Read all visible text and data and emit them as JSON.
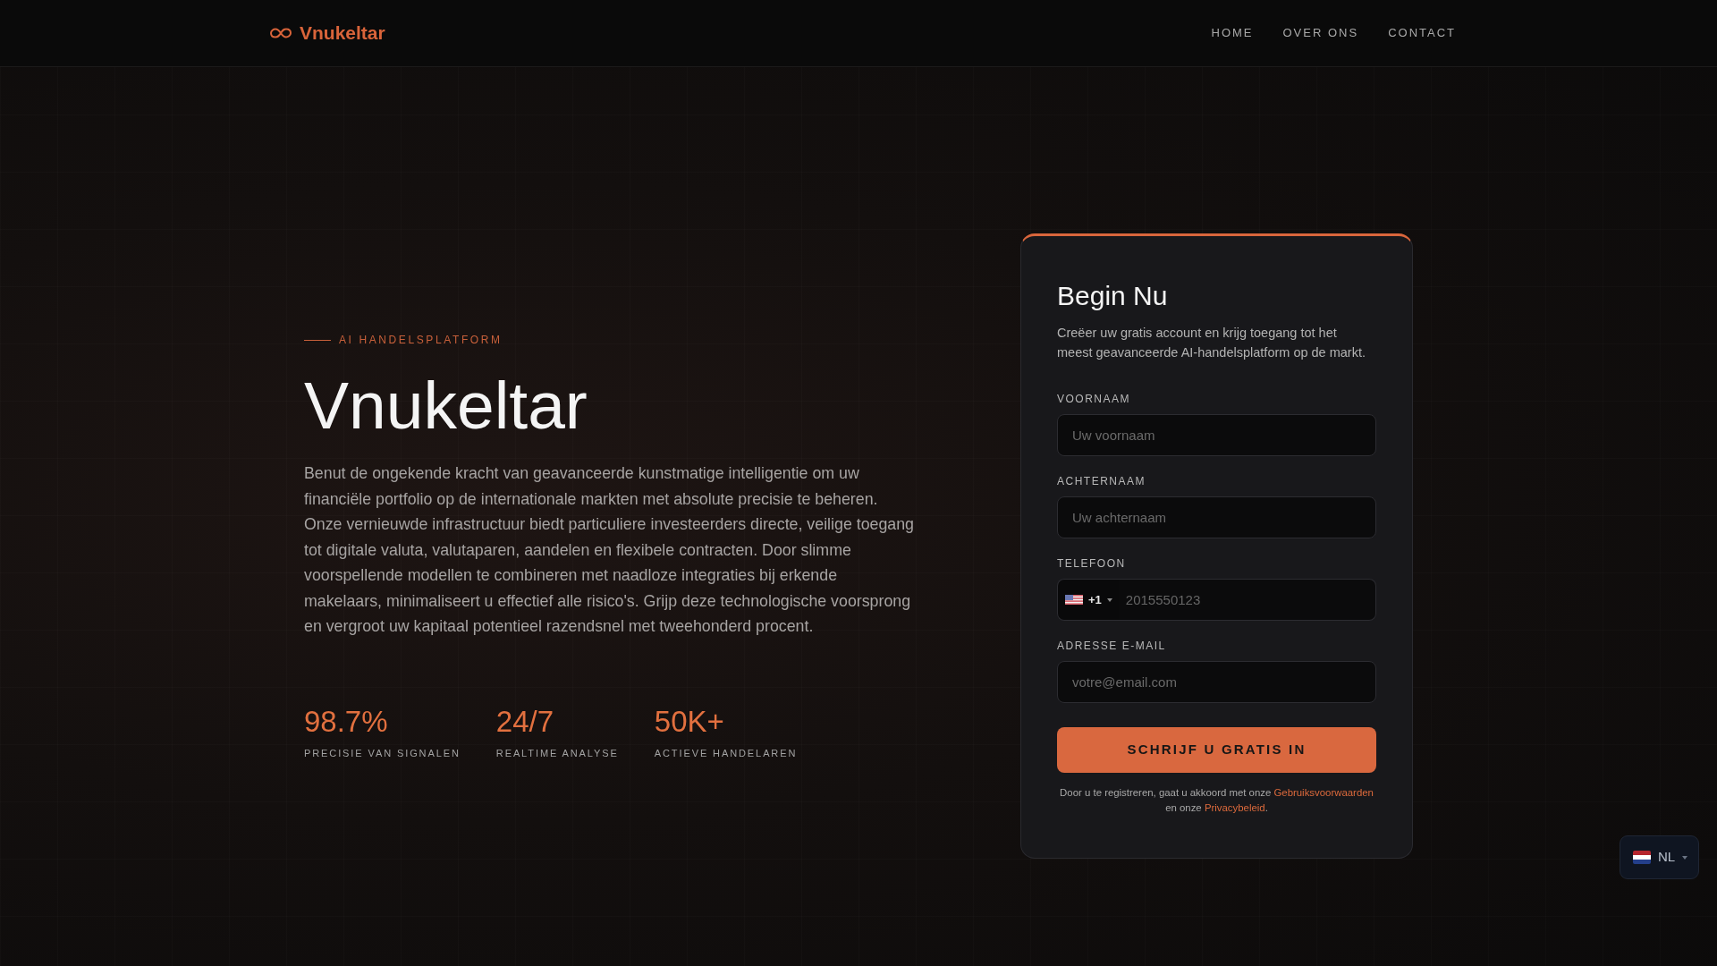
{
  "header": {
    "logo": "Vnukeltar",
    "nav": [
      {
        "label": "HOME"
      },
      {
        "label": "OVER ONS"
      },
      {
        "label": "CONTACT"
      }
    ]
  },
  "hero": {
    "eyebrow": "AI HANDELSPLATFORM",
    "title": "Vnukeltar",
    "description": "Benut de ongekende kracht van geavanceerde kunstmatige intelligentie om uw financiële portfolio op de internationale markten met absolute precisie te beheren. Onze vernieuwde infrastructuur biedt particuliere investeerders directe, veilige toegang tot digitale valuta, valutaparen, aandelen en flexibele contracten. Door slimme voorspellende modellen te combineren met naadloze integraties bij erkende makelaars, minimaliseert u effectief alle risico's. Grijp deze technologische voorsprong en vergroot uw kapitaal potentieel razendsnel met tweehonderd procent.",
    "stats": [
      {
        "value": "98.7%",
        "label": "PRECISIE VAN SIGNALEN"
      },
      {
        "value": "24/7",
        "label": "REALTIME ANALYSE"
      },
      {
        "value": "50K+",
        "label": "ACTIEVE HANDELAREN"
      }
    ]
  },
  "signup_form": {
    "title": "Begin Nu",
    "description": "Creëer uw gratis account en krijg toegang tot het meest geavanceerde AI-handelsplatform op de markt.",
    "fields": [
      {
        "kind": "text",
        "label": "VOORNAAM",
        "placeholder": "Uw voornaam"
      },
      {
        "kind": "text",
        "label": "ACHTERNAAM",
        "placeholder": "Uw achternaam"
      },
      {
        "kind": "phone",
        "label": "TELEFOON",
        "country_code": "+1",
        "placeholder": "2015550123"
      },
      {
        "kind": "email",
        "label": "ADRESSE E-MAIL",
        "placeholder": "votre@email.com"
      }
    ],
    "submit_button": "SCHRIJF U GRATIS IN",
    "terms": {
      "text": "Door u te registreren, gaat u akkoord met onze",
      "terms_link": "Gebruiksvoorwaarden",
      "middle": "en onze",
      "privacy_link": "Privacybeleid",
      "end": "."
    }
  },
  "language_selector": {
    "label": "NL"
  }
}
